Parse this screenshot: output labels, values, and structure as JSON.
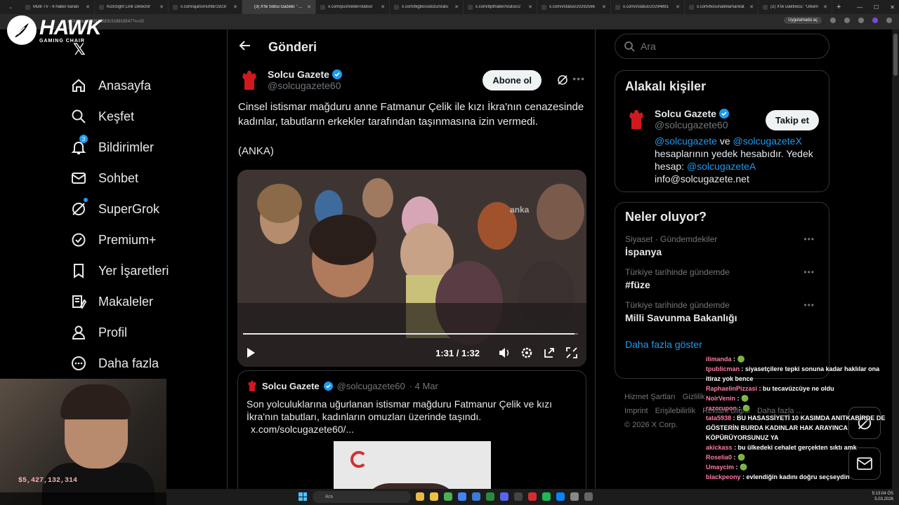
{
  "browser": {
    "tabs": [
      {
        "label": "Multi TV - 6 haber kanalı"
      },
      {
        "label": "KickSight Link Detector"
      },
      {
        "label": "x.com/ajansmuhbir1923/"
      },
      {
        "label": "(3) X'te Solcu Gazete: \"Cin"
      },
      {
        "label": "x.com/pusholder/status/"
      },
      {
        "label": "x.com/bigbossdozu/statu"
      },
      {
        "label": "x.com/bpthaber/status/2"
      },
      {
        "label": "x.com/i/status/20292566"
      },
      {
        "label": "x.com/i/status/20294881"
      },
      {
        "label": "x.com/bosunatiklama/stat"
      },
      {
        "label": "(2) X'te Daktilocu: \"Ülkem"
      }
    ],
    "url": "x60/status/2029155831518818547?s=20",
    "open_in_app": "Uygulamada aç"
  },
  "overlay": {
    "brand": "HAWK",
    "brand_sub": "GAMING CHAIR",
    "money": "$5,427,132,314"
  },
  "nav": {
    "items": [
      {
        "label": "Anasayfa",
        "icon": "home-icon"
      },
      {
        "label": "Keşfet",
        "icon": "search-icon"
      },
      {
        "label": "Bildirimler",
        "icon": "bell-icon",
        "badge": "3"
      },
      {
        "label": "Sohbet",
        "icon": "mail-icon"
      },
      {
        "label": "SuperGrok",
        "icon": "grok-icon"
      },
      {
        "label": "Premium+",
        "icon": "premium-icon"
      },
      {
        "label": "Yer İşaretleri",
        "icon": "bookmark-icon"
      },
      {
        "label": "Makaleler",
        "icon": "articles-icon"
      },
      {
        "label": "Profil",
        "icon": "profile-icon"
      },
      {
        "label": "Daha fazla",
        "icon": "more-icon"
      }
    ]
  },
  "post": {
    "header": "Gönderi",
    "author_name": "Solcu Gazete",
    "author_handle": "@solcugazete60",
    "subscribe_label": "Abone ol",
    "text": "Cinsel istismar mağduru anne Fatmanur Çelik ile kızı İkra'nın cenazesinde kadınlar, tabutların erkekler tarafından taşınmasına izin vermedi.",
    "source": "(ANKA)",
    "video_time": "1:31 / 1:32",
    "video_progress": 0.99,
    "watermark": "anka"
  },
  "quote": {
    "author_name": "Solcu Gazete",
    "author_handle": "@solcugazete60",
    "date": "· 4 Mar",
    "text": "Son yolculuklarına uğurlanan istismar mağduru Fatmanur Çelik ve kızı İkra'nın tabutları, kadınların omuzları üzerinde taşındı.",
    "link": "x.com/solcugazete60/..."
  },
  "right": {
    "search_placeholder": "Ara",
    "related_title": "Alakalı kişiler",
    "related_name": "Solcu Gazete",
    "related_handle": "@solcugazete60",
    "follow_label": "Takip et",
    "bio_link1": "@solcugazete",
    "bio_and": " ve ",
    "bio_link2": "@solcugazeteX",
    "bio_mid": " hesaplarının yedek hesabıdır. Yedek hesap: ",
    "bio_link3": "@solcugazeteA",
    "bio_email": "info@solcugazete.net",
    "trending_title": "Neler oluyor?",
    "trends": [
      {
        "category": "Siyaset · Gündemdekiler",
        "title": "İspanya"
      },
      {
        "category": "Türkiye tarihinde gündemde",
        "title": "#füze"
      },
      {
        "category": "Türkiye tarihinde gündemde",
        "title": "Milli Savunma Bakanlığı"
      }
    ],
    "show_more": "Daha fazla göster",
    "footer": [
      "Hizmet Şartları",
      "Gizlilik",
      "Imprint",
      "Erişilebilirlik",
      "Reklam bilgisi",
      "Daha fazla ...",
      "© 2026 X Corp."
    ]
  },
  "chat": [
    {
      "user": "ilimanda",
      "text": ": 🟢"
    },
    {
      "user": "tpublicman",
      "text": ": siyasetçilere tepki sonuna kadar haklılar ona itiraz yok bence"
    },
    {
      "user": "RaphaelinPizzasi",
      "text": ": bu tecavüzcüye ne oldu"
    },
    {
      "user": "NoirVenin",
      "text": ": 🟢"
    },
    {
      "user": "razorupon",
      "text": ": 🟢"
    },
    {
      "user": "tata5938",
      "text": ": BU HASASSİYETİ 10 KASIMDA ANITKABİRDE DE GÖSTERİN BURDA KADINLAR HAK ARAYINCA KÖPÜRÜYORSUNUZ YA"
    },
    {
      "user": "akickass",
      "text": ": bu ülkedeki cehalet gerçekten sıktı amk"
    },
    {
      "user": "Roselia0",
      "text": ": 🟢"
    },
    {
      "user": "Umaycim",
      "text": ": 🟢"
    },
    {
      "user": "blackpeony",
      "text": ": evlendiğin kadını doğru seçseydin"
    }
  ],
  "taskbar": {
    "search": "Ara",
    "time": "5:13:04 ÖS",
    "date": "5.03.2026"
  },
  "colors": {
    "accent": "#1d9bf0",
    "background": "#000000",
    "border": "#2f3336"
  }
}
